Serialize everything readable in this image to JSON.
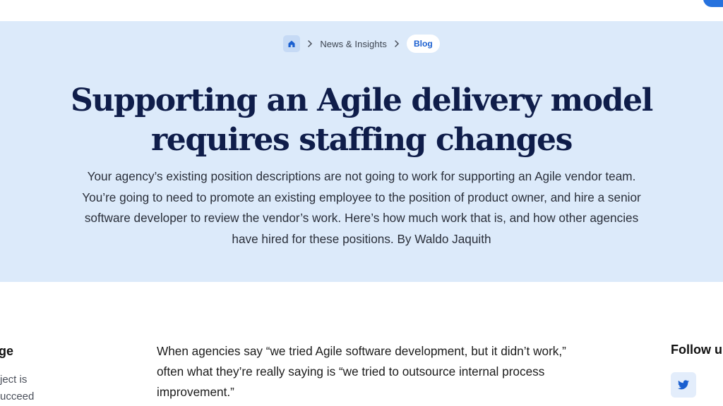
{
  "breadcrumb": {
    "home_icon": "home-icon",
    "separator_icon": "chevron-right-icon",
    "items": [
      "News & Insights"
    ],
    "current": "Blog"
  },
  "hero": {
    "title_line1": "Supporting an Agile delivery model",
    "title_line2": "requires staffing changes",
    "subtitle": "Your agency’s existing position descriptions are not going to work for supporting an Agile vendor team. You’re going to need to promote an existing employee to the position of product owner, and hire a senior software developer to review the vendor’s work. Here’s how much work that is, and how other agencies have hired for these positions. By Waldo Jaquith"
  },
  "left_sidebar": {
    "heading": "ge",
    "lines": [
      "ject is",
      "ucceed"
    ]
  },
  "article": {
    "paragraph1": "When agencies say “we tried Agile software development, but it didn’t work,” often what they’re really saying is “we tried to outsource internal process improvement.”"
  },
  "right_sidebar": {
    "heading": "Follow u",
    "social_icon": "twitter-icon"
  },
  "colors": {
    "hero_background": "#dceafa",
    "title": "#0f1d4a",
    "accent": "#2672de"
  }
}
